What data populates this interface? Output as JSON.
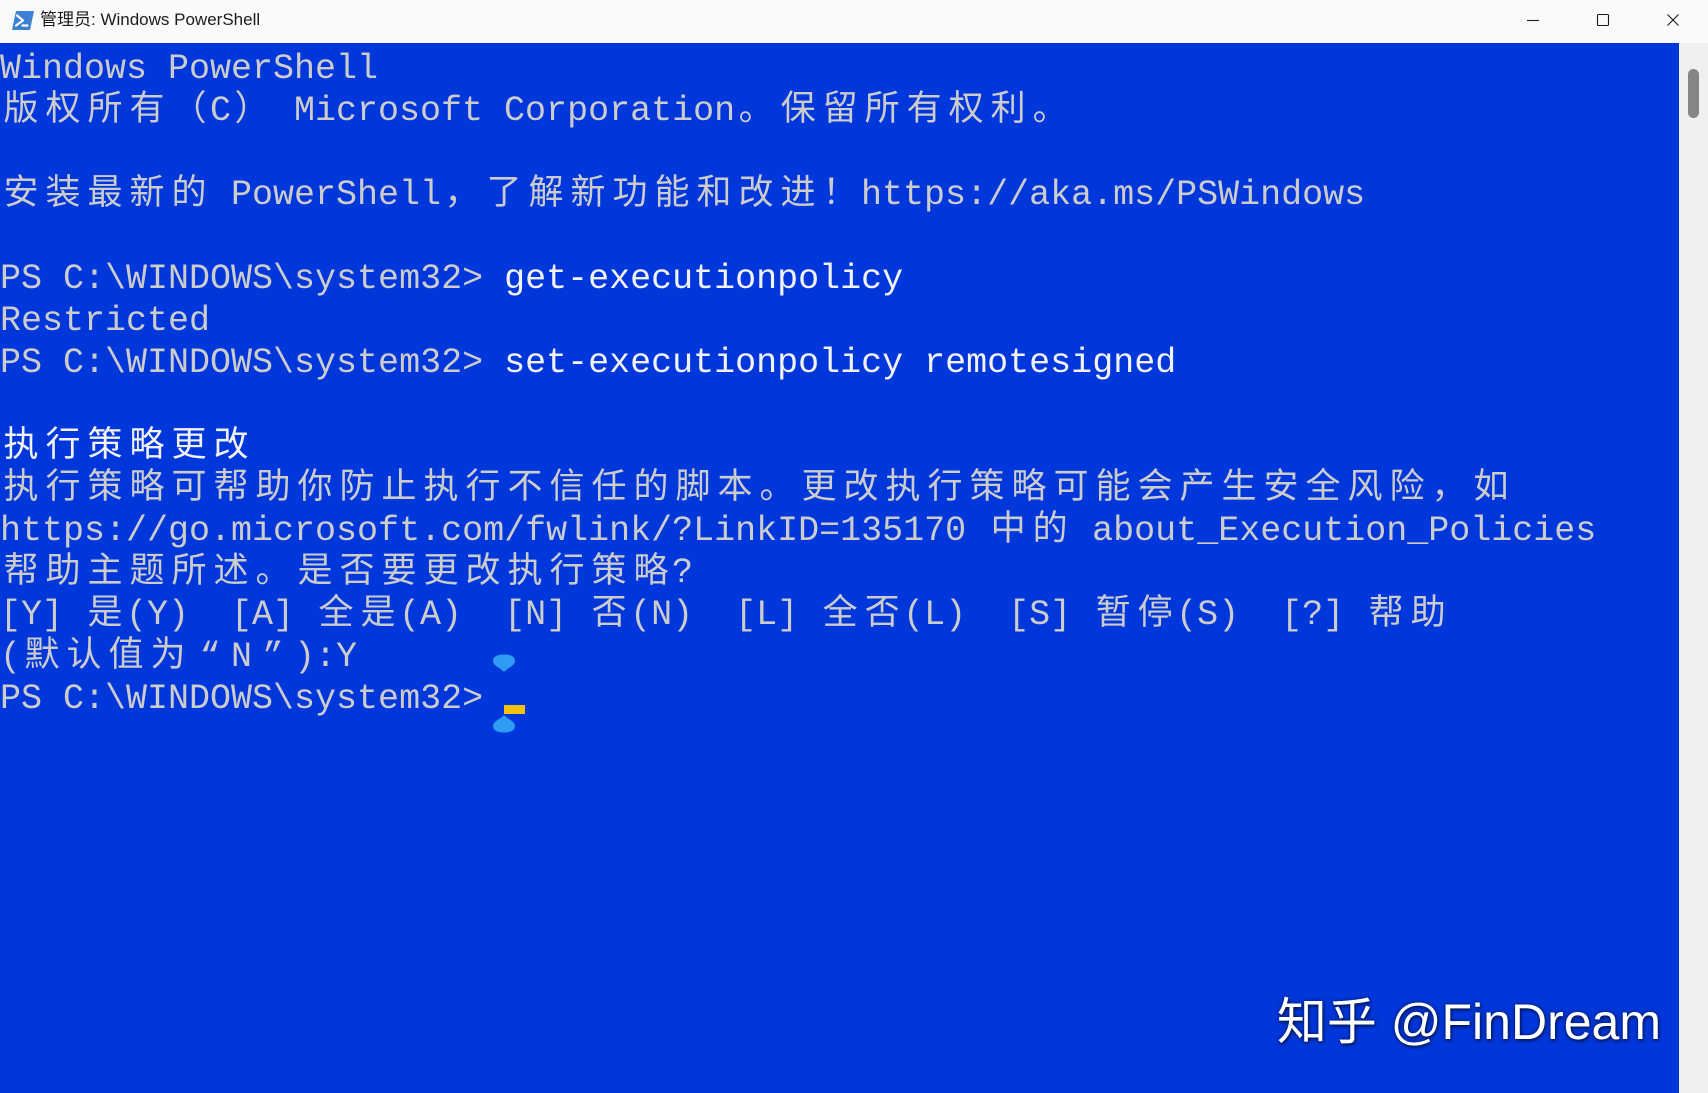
{
  "window": {
    "title": "管理员: Windows PowerShell",
    "icons": {
      "app": "powershell-icon",
      "minimize": "minimize-icon",
      "maximize": "maximize-icon",
      "close": "close-icon"
    }
  },
  "console": {
    "lines": [
      {
        "text": "Windows PowerShell"
      },
      {
        "text": "版权所有（C） Microsoft Corporation。保留所有权利。"
      },
      {
        "text": "安装最新的 PowerShell，了解新功能和改进！https://aka.ms/PSWindows"
      },
      {
        "prompt": "PS C:\\WINDOWS\\system32>",
        "command": "get-executionpolicy"
      },
      {
        "text": "Restricted"
      },
      {
        "prompt": "PS C:\\WINDOWS\\system32>",
        "command": "set-executionpolicy remotesigned"
      },
      {
        "text": "执行策略更改",
        "color": "#f2f2f2"
      },
      {
        "text": "执行策略可帮助你防止执行不信任的脚本。更改执行策略可能会产生安全风险，如"
      },
      {
        "text": "https://go.microsoft.com/fwlink/?LinkID=135170 中的 about_Execution_Policies"
      },
      {
        "text": "帮助主题所述。是否要更改执行策略?"
      },
      {
        "text": "[Y] 是(Y)  [A] 全是(A)  [N] 否(N)  [L] 全否(L)  [S] 暂停(S)  [?] 帮助"
      },
      {
        "text": "(默认值为“N”):Y"
      },
      {
        "prompt": "PS C:\\WINDOWS\\system32>"
      }
    ]
  },
  "watermark": {
    "text": "知乎 @FinDream"
  },
  "colors": {
    "title_bar_background": "#fafafa",
    "title_bar_text": "#1b1b1b",
    "app_icon": "#3c82d4",
    "console_background": "#0037da",
    "console_text": "#cccccc",
    "input_text": "#f2f2f2",
    "cursor": "#f5c211",
    "cursor_indicator": "#2f9cf3",
    "scrollbar_track": "#f0f0f0",
    "scrollbar_thumb": "#858585",
    "watermark_text": "#ffffff"
  }
}
